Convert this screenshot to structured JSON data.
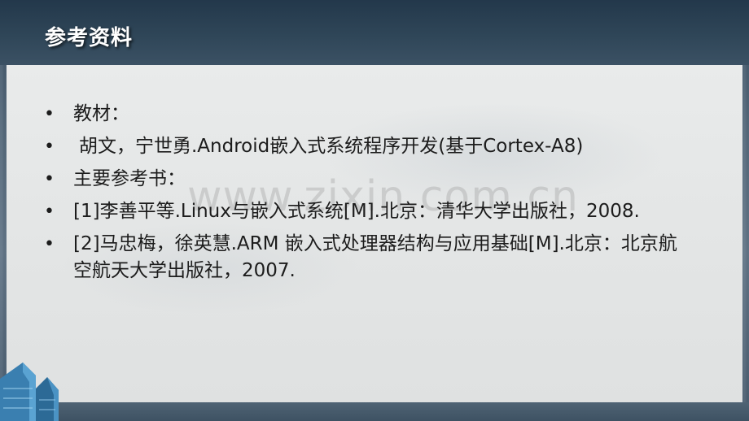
{
  "title": "参考资料",
  "watermark": "www.zixin.com.cn",
  "bullets": [
    {
      "text": "教材："
    },
    {
      "text": "胡文，宁世勇.Android嵌入式系统程序开发(基于Cortex-A8)"
    },
    {
      "text": "主要参考书："
    },
    {
      "text": "[1]李善平等.Linux与嵌入式系统[M].北京：清华大学出版社，2008."
    },
    {
      "text": "[2]马忠梅，徐英慧.ARM 嵌入式处理器结构与应用基础[M].北京：北京航空航天大学出版社，2007."
    }
  ],
  "bullet_glyph": "•",
  "colors": {
    "title_bar": "#2f4658",
    "panel": "#e6e8e8",
    "text": "#1c1c1c"
  }
}
